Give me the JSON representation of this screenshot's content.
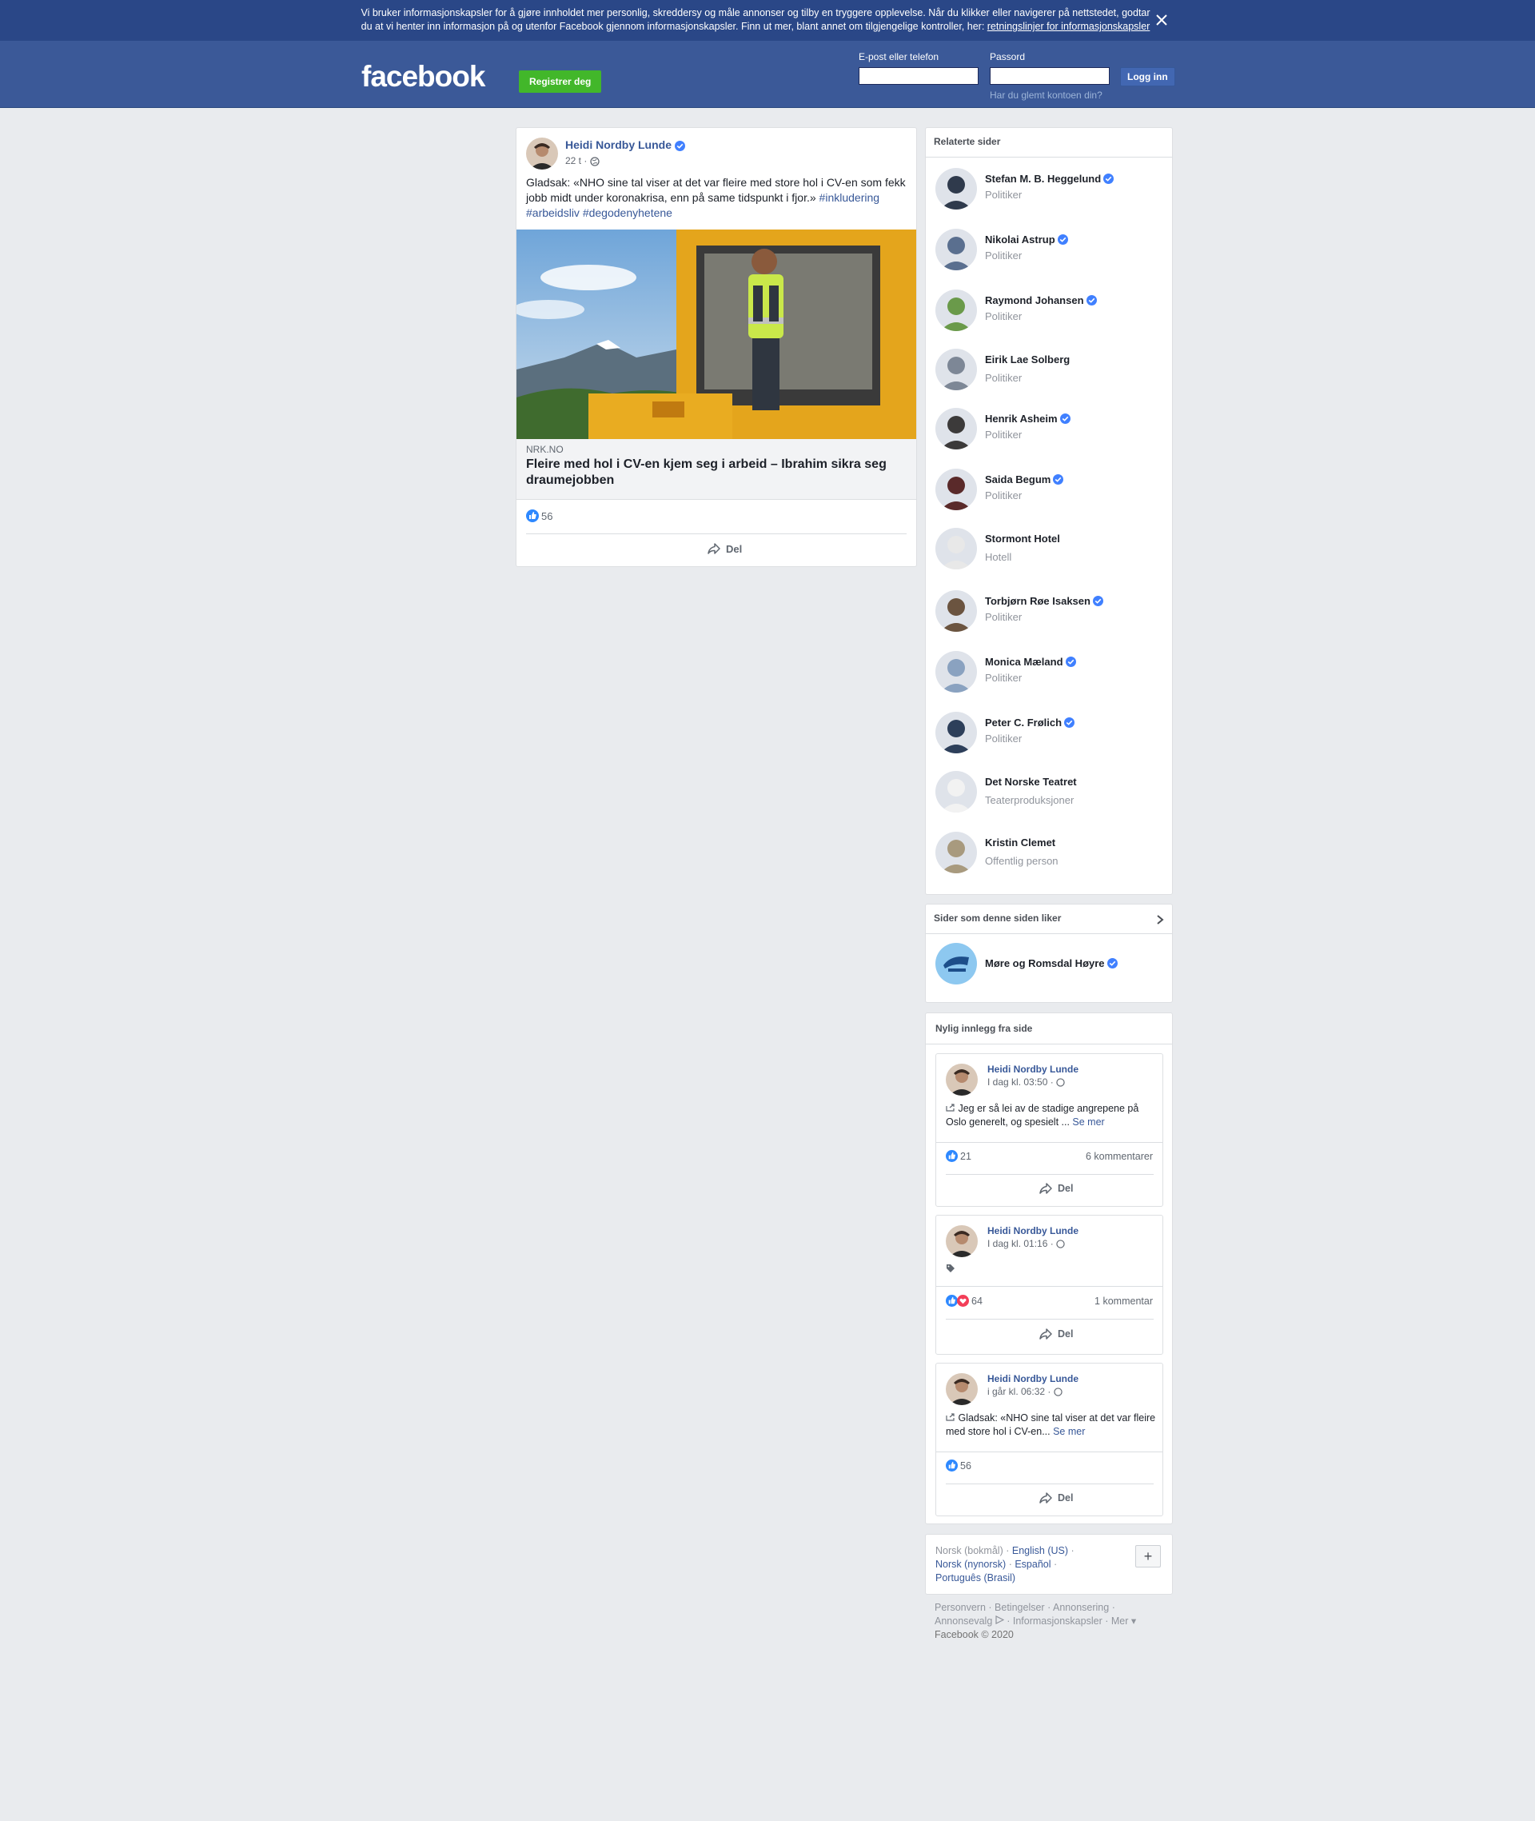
{
  "cookie_banner": {
    "text": "Vi bruker informasjonskapsler for å gjøre innholdet mer personlig, skreddersy og måle annonser og tilby en tryggere opplevelse. Når du klikker eller navigerer på nettstedet, godtar du at vi henter inn informasjon på og utenfor Facebook gjennom informasjonskapsler. Finn ut mer, blant annet om tilgjengelige kontroller, her: ",
    "link": "retningslinjer for informasjonskapsler"
  },
  "header": {
    "logo": "facebook",
    "register_label": "Registrer deg",
    "email_label": "E-post eller telefon",
    "password_label": "Passord",
    "email_value": "",
    "password_value": "",
    "login_label": "Logg inn",
    "forgot_label": "Har du glemt kontoen din?"
  },
  "post": {
    "author": "Heidi Nordby Lunde",
    "time": "22 t ·",
    "text": "Gladsak: «NHO sine tal viser at det var fleire med store hol i CV-en som fekk jobb midt under koronakrisa, enn på same tidspunkt i fjor.» ",
    "hashtag1": "#inkludering",
    "hashtag2": "#arbeidsliv",
    "hashtag3": "#degodenyhetene",
    "link_domain": "nrk.no",
    "link_headline": "Fleire med hol i CV-en kjem seg i arbeid – Ibrahim sikra seg draumejobben",
    "reactions": "56",
    "share_label": "Del"
  },
  "related": {
    "title": "Relaterte sider",
    "items": [
      {
        "name": "Stefan M. B. Heggelund",
        "category": "Politiker",
        "verified": true,
        "color": "#2f3a4c"
      },
      {
        "name": "Nikolai Astrup",
        "category": "Politiker",
        "verified": true,
        "color": "#5a6f8f"
      },
      {
        "name": "Raymond Johansen",
        "category": "Politiker",
        "verified": true,
        "color": "#6a9a4a"
      },
      {
        "name": "Eirik Lae Solberg",
        "category": "Politiker",
        "verified": false,
        "color": "#7d8796"
      },
      {
        "name": "Henrik Asheim",
        "category": "Politiker",
        "verified": true,
        "color": "#3c3a3a"
      },
      {
        "name": "Saida Begum",
        "category": "Politiker",
        "verified": true,
        "color": "#5a2a2a"
      },
      {
        "name": "Stormont Hotel",
        "category": "Hotell",
        "verified": false,
        "color": "#e8e8e8"
      },
      {
        "name": "Torbjørn Røe Isaksen",
        "category": "Politiker",
        "verified": true,
        "color": "#6b5440"
      },
      {
        "name": "Monica Mæland",
        "category": "Politiker",
        "verified": true,
        "color": "#8aa2c0"
      },
      {
        "name": "Peter C. Frølich",
        "category": "Politiker",
        "verified": true,
        "color": "#2d3f5a"
      },
      {
        "name": "Det Norske Teatret",
        "category": "Teaterproduksjoner",
        "verified": false,
        "color": "#f2f2f2"
      },
      {
        "name": "Kristin Clemet",
        "category": "Offentlig person",
        "verified": false,
        "color": "#a89a7e"
      }
    ]
  },
  "liked": {
    "title": "Sider som denne siden liker",
    "item": "Møre og Romsdal Høyre"
  },
  "recent": {
    "title": "Nylig innlegg fra side",
    "posts": [
      {
        "author": "Heidi Nordby Lunde",
        "time": "I dag kl. 03:50 ·",
        "text": "Jeg er så lei av de stadige angrepene på Oslo generelt, og spesielt ... ",
        "more": "Se mer",
        "reactions": "21",
        "comments": "6 kommentarer",
        "share": "Del"
      },
      {
        "author": "Heidi Nordby Lunde",
        "time": "I dag kl. 01:16 ·",
        "text": "",
        "more": "",
        "reactions": "64",
        "comments": "1 kommentar",
        "share": "Del"
      },
      {
        "author": "Heidi Nordby Lunde",
        "time": "i går kl. 06:32 ·",
        "text": "Gladsak: «NHO sine tal viser at det var fleire med store hol i CV-en... ",
        "more": "Se mer",
        "reactions": "56",
        "comments": "",
        "share": "Del"
      }
    ]
  },
  "language": {
    "current": "Norsk (bokmål)",
    "links": [
      "English (US)",
      "Norsk (nynorsk)",
      "Español",
      "Português (Brasil)"
    ],
    "plus": "+"
  },
  "footer": {
    "links": [
      "Personvern",
      "Betingelser",
      "Annonsering",
      "Annonsevalg",
      "Informasjonskapsler",
      "Mer"
    ],
    "copyright": "Facebook © 2020"
  },
  "colors": {
    "brand": "#3b5998",
    "banner": "#2a4787",
    "register": "#42b72a",
    "link": "#385898",
    "verified": "#4080ff"
  }
}
